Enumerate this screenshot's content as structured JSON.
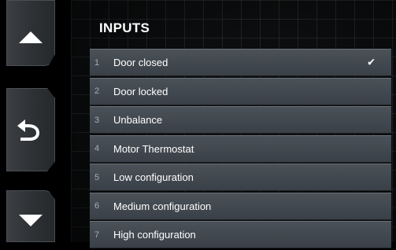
{
  "header": {
    "title": "INPUTS"
  },
  "nav": {
    "up_icon": "triangle-up-icon",
    "back_icon": "undo-arrow-icon",
    "down_icon": "triangle-down-icon"
  },
  "inputs": [
    {
      "number": "1",
      "label": "Door closed",
      "checked": true,
      "check_mark": "✔"
    },
    {
      "number": "2",
      "label": "Door locked",
      "checked": false
    },
    {
      "number": "3",
      "label": "Unbalance",
      "checked": false
    },
    {
      "number": "4",
      "label": "Motor Thermostat",
      "checked": false
    },
    {
      "number": "5",
      "label": "Low configuration",
      "checked": false
    },
    {
      "number": "6",
      "label": "Medium configuration",
      "checked": false
    },
    {
      "number": "7",
      "label": "High configuration",
      "checked": false
    }
  ],
  "colors": {
    "background": "#000000",
    "row_fill": "#434a51",
    "text": "#ffffff",
    "number_text": "#a7adb3",
    "button_fill": "#2e3134"
  }
}
